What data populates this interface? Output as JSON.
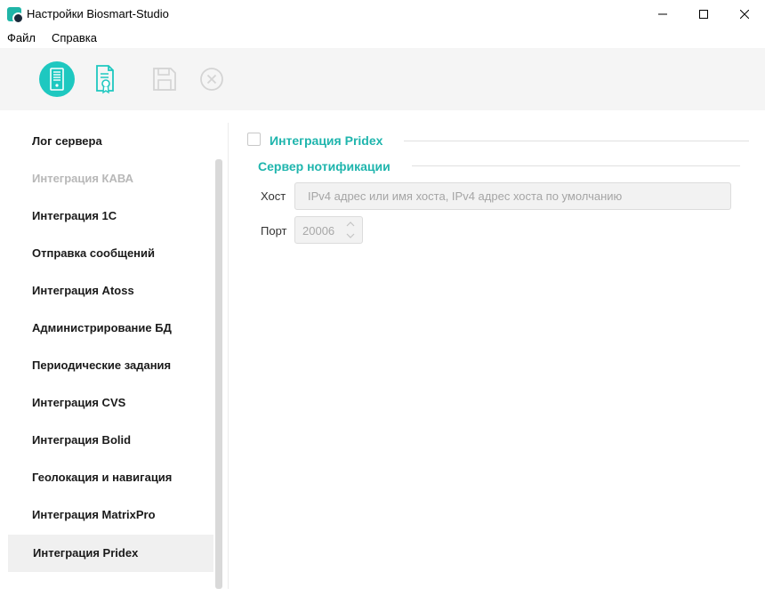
{
  "window": {
    "title": "Настройки Biosmart-Studio",
    "icons": [
      "app-logo-icon",
      "minimize-icon",
      "maximize-icon",
      "close-icon"
    ]
  },
  "menu": {
    "items": [
      {
        "label": "Файл"
      },
      {
        "label": "Справка"
      }
    ]
  },
  "toolbar": {
    "buttons": [
      {
        "icon": "server-icon",
        "active": true
      },
      {
        "icon": "license-certificate-icon",
        "active": false
      },
      {
        "icon": "save-icon",
        "enabled": false
      },
      {
        "icon": "cancel-icon",
        "enabled": false
      }
    ],
    "accent": "#1ec8c0"
  },
  "sidebar": {
    "items": [
      {
        "label": "Лог сервера",
        "enabled": true
      },
      {
        "label": "Интеграция КАВА",
        "enabled": false
      },
      {
        "label": "Интеграция 1С",
        "enabled": true
      },
      {
        "label": "Отправка сообщений",
        "enabled": true
      },
      {
        "label": "Интеграция Atoss",
        "enabled": true
      },
      {
        "label": "Администрирование БД",
        "enabled": true
      },
      {
        "label": "Периодические задания",
        "enabled": true
      },
      {
        "label": "Интеграция CVS",
        "enabled": true
      },
      {
        "label": "Интеграция Bolid",
        "enabled": true
      },
      {
        "label": "Геолокация и навигация",
        "enabled": true
      },
      {
        "label": "Интеграция MatrixPro",
        "enabled": true
      },
      {
        "label": "Интеграция Pridex",
        "enabled": true,
        "selected": true
      }
    ]
  },
  "content": {
    "enable_label": "Интеграция Pridex",
    "enabled_checked": false,
    "notify_section": "Сервер нотификации",
    "host": {
      "label": "Хост",
      "value": "",
      "placeholder": "IPv4 адрес или имя хоста, IPv4 адрес хоста по умолчанию"
    },
    "port": {
      "label": "Порт",
      "value": "20006"
    },
    "accent": "#1fb5ad"
  }
}
